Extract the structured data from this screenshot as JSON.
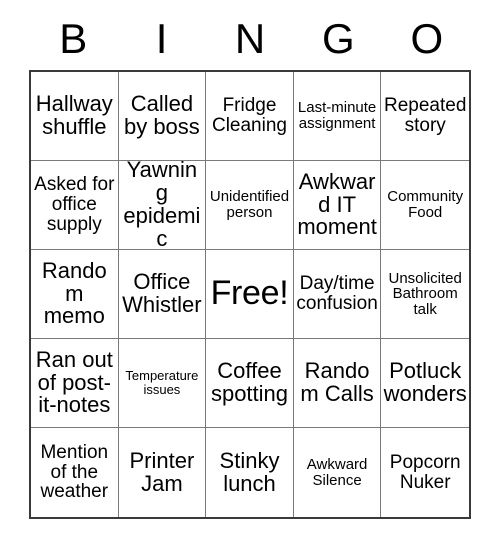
{
  "card": {
    "header": {
      "letters": [
        "B",
        "I",
        "N",
        "G",
        "O"
      ]
    },
    "cells": [
      {
        "text": "Hallway shuffle",
        "size": "lg",
        "free": false
      },
      {
        "text": "Called by boss",
        "size": "lg",
        "free": false
      },
      {
        "text": "Fridge Cleaning",
        "size": "md",
        "free": false
      },
      {
        "text": "Last-minute assignment",
        "size": "sm",
        "free": false
      },
      {
        "text": "Repeated story",
        "size": "md",
        "free": false
      },
      {
        "text": "Asked for office supply",
        "size": "md",
        "free": false
      },
      {
        "text": "Yawning epidemic",
        "size": "lg",
        "free": false
      },
      {
        "text": "Unidentified person",
        "size": "sm",
        "free": false
      },
      {
        "text": "Awkward IT moment",
        "size": "lg",
        "free": false
      },
      {
        "text": "Community Food",
        "size": "sm",
        "free": false
      },
      {
        "text": "Random memo",
        "size": "lg",
        "free": false
      },
      {
        "text": "Office Whistler",
        "size": "lg",
        "free": false
      },
      {
        "text": "Free!",
        "size": "xl",
        "free": true
      },
      {
        "text": "Day/time confusion",
        "size": "md",
        "free": false
      },
      {
        "text": "Unsolicited Bathroom talk",
        "size": "sm",
        "free": false
      },
      {
        "text": "Ran out of post-it-notes",
        "size": "lg",
        "free": false
      },
      {
        "text": "Temperature issues",
        "size": "xs",
        "free": false
      },
      {
        "text": "Coffee spotting",
        "size": "lg",
        "free": false
      },
      {
        "text": "Random Calls",
        "size": "lg",
        "free": false
      },
      {
        "text": "Potluck wonders",
        "size": "lg",
        "free": false
      },
      {
        "text": "Mention of the weather",
        "size": "md",
        "free": false
      },
      {
        "text": "Printer Jam",
        "size": "lg",
        "free": false
      },
      {
        "text": "Stinky lunch",
        "size": "lg",
        "free": false
      },
      {
        "text": "Awkward Silence",
        "size": "sm",
        "free": false
      },
      {
        "text": "Popcorn Nuker",
        "size": "md",
        "free": false
      }
    ]
  },
  "colors": {
    "background": "#ffffff",
    "text": "#000000",
    "inner_border": "#7a7a7a",
    "outer_border": "#3a3a3a"
  }
}
